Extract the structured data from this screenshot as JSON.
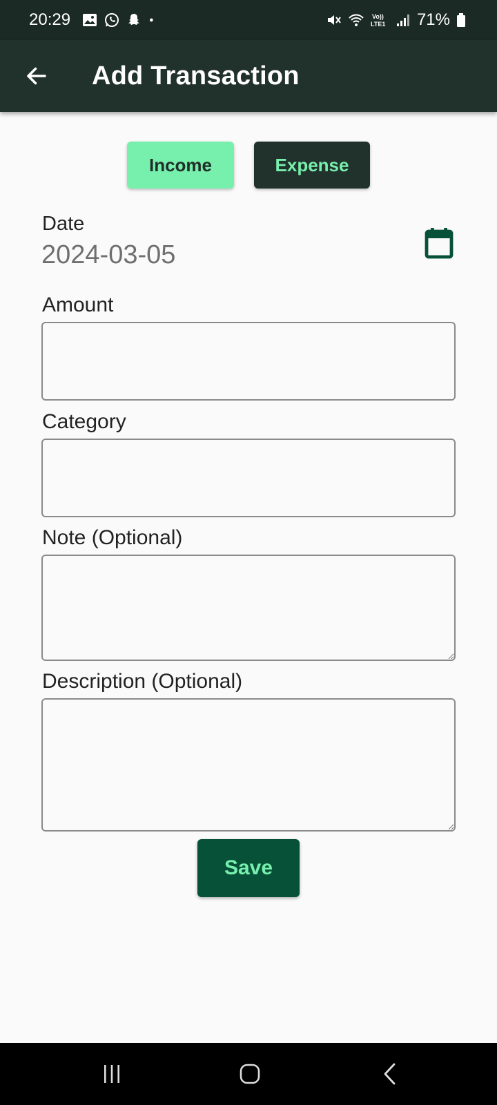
{
  "status_bar": {
    "time": "20:29",
    "battery": "71%",
    "left_icons": [
      "gallery-icon",
      "whatsapp-icon",
      "snapchat-icon",
      "dot-icon"
    ],
    "right_icons": [
      "mute-icon",
      "wifi-icon",
      "volte-icon",
      "signal-icon",
      "battery-icon"
    ],
    "volte_text": "Vo))\nLTE1"
  },
  "app_bar": {
    "title": "Add Transaction",
    "back_icon": "arrow-left-icon"
  },
  "type_toggle": {
    "income_label": "Income",
    "expense_label": "Expense",
    "selected": "Income"
  },
  "date": {
    "label": "Date",
    "value": "2024-03-05",
    "icon": "calendar-icon"
  },
  "fields": {
    "amount_label": "Amount",
    "amount_value": "",
    "category_label": "Category",
    "category_value": "",
    "note_label": "Note (Optional)",
    "note_value": "",
    "description_label": "Description (Optional)",
    "description_value": ""
  },
  "save_label": "Save",
  "colors": {
    "app_bar": "#21312b",
    "status_bar": "#1c2a25",
    "accent": "#77efad",
    "save_bg": "#065137",
    "background": "#fafafa"
  },
  "nav_bar": {
    "icons": [
      "recents-icon",
      "home-icon",
      "back-icon"
    ]
  }
}
